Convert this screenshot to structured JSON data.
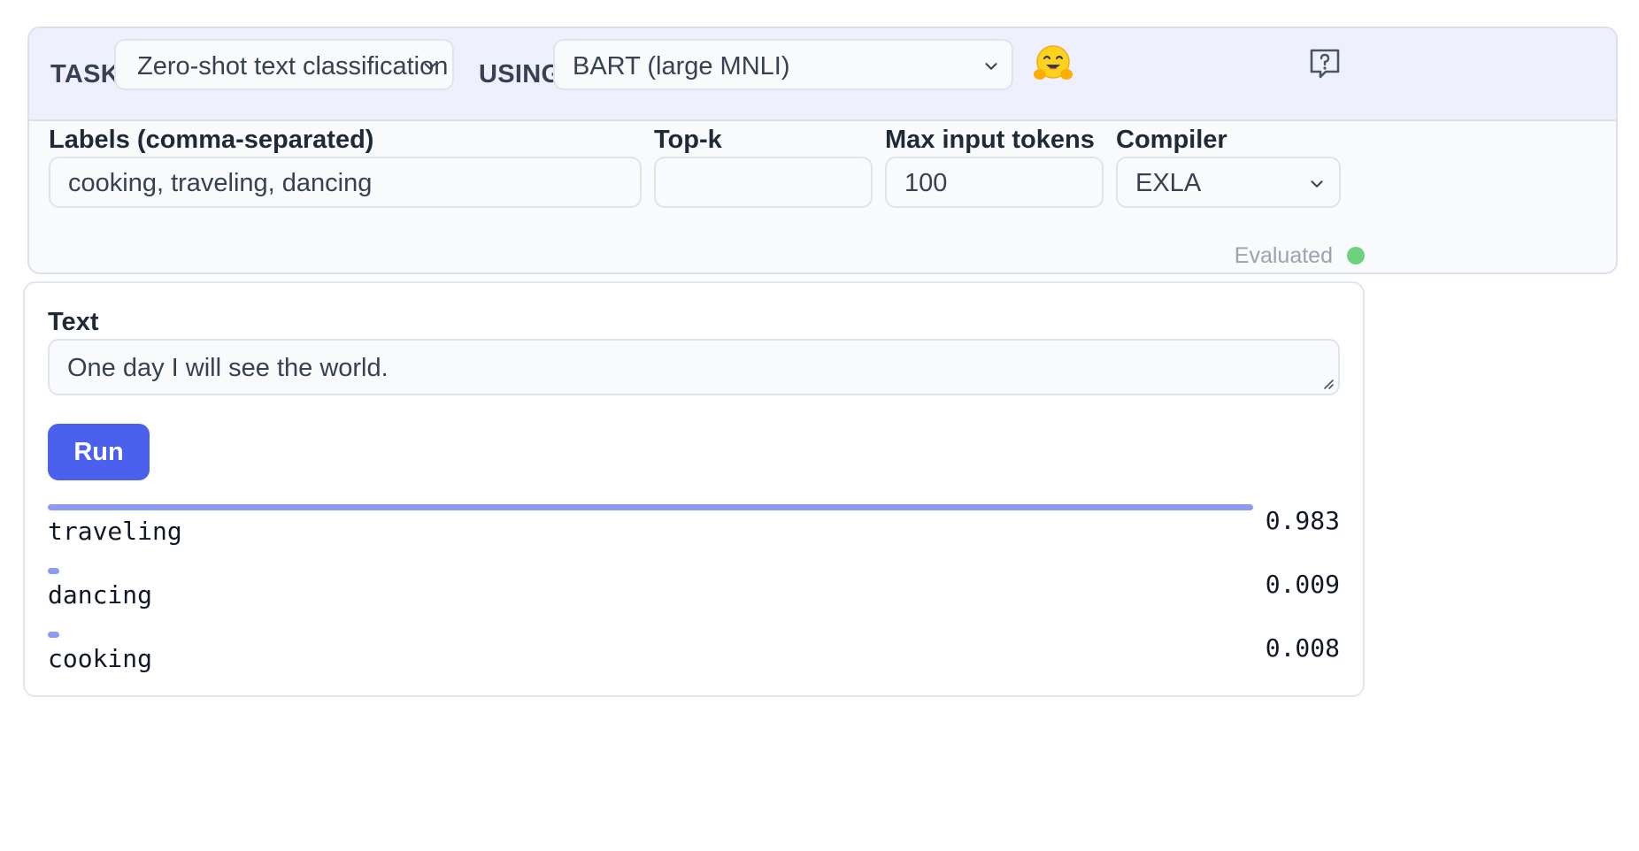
{
  "header": {
    "task_label": "TASK",
    "task_value": "Zero-shot text classification",
    "using_label": "USING",
    "model_value": "BART (large MNLI)",
    "help_icon": "help-question-icon",
    "logo_icon": "hugging-face-icon"
  },
  "fields": {
    "labels": {
      "label": "Labels (comma-separated)",
      "value": "cooking, traveling, dancing"
    },
    "top_k": {
      "label": "Top-k",
      "value": ""
    },
    "max_tokens": {
      "label": "Max input tokens",
      "value": "100"
    },
    "compiler": {
      "label": "Compiler",
      "value": "EXLA"
    }
  },
  "status": {
    "text": "Evaluated",
    "color": "#6dd37f"
  },
  "input": {
    "label": "Text",
    "value": "One day I will see the world."
  },
  "run_button": {
    "label": "Run",
    "color": "#4b61ee"
  },
  "results": [
    {
      "label": "traveling",
      "score": "0.983",
      "value": 0.983
    },
    {
      "label": "dancing",
      "score": "0.009",
      "value": 0.009
    },
    {
      "label": "cooking",
      "score": "0.008",
      "value": 0.008
    }
  ],
  "colors": {
    "accent": "#4b61ee",
    "bar": "#8b9cf0",
    "header_bg": "#eef1fd"
  }
}
